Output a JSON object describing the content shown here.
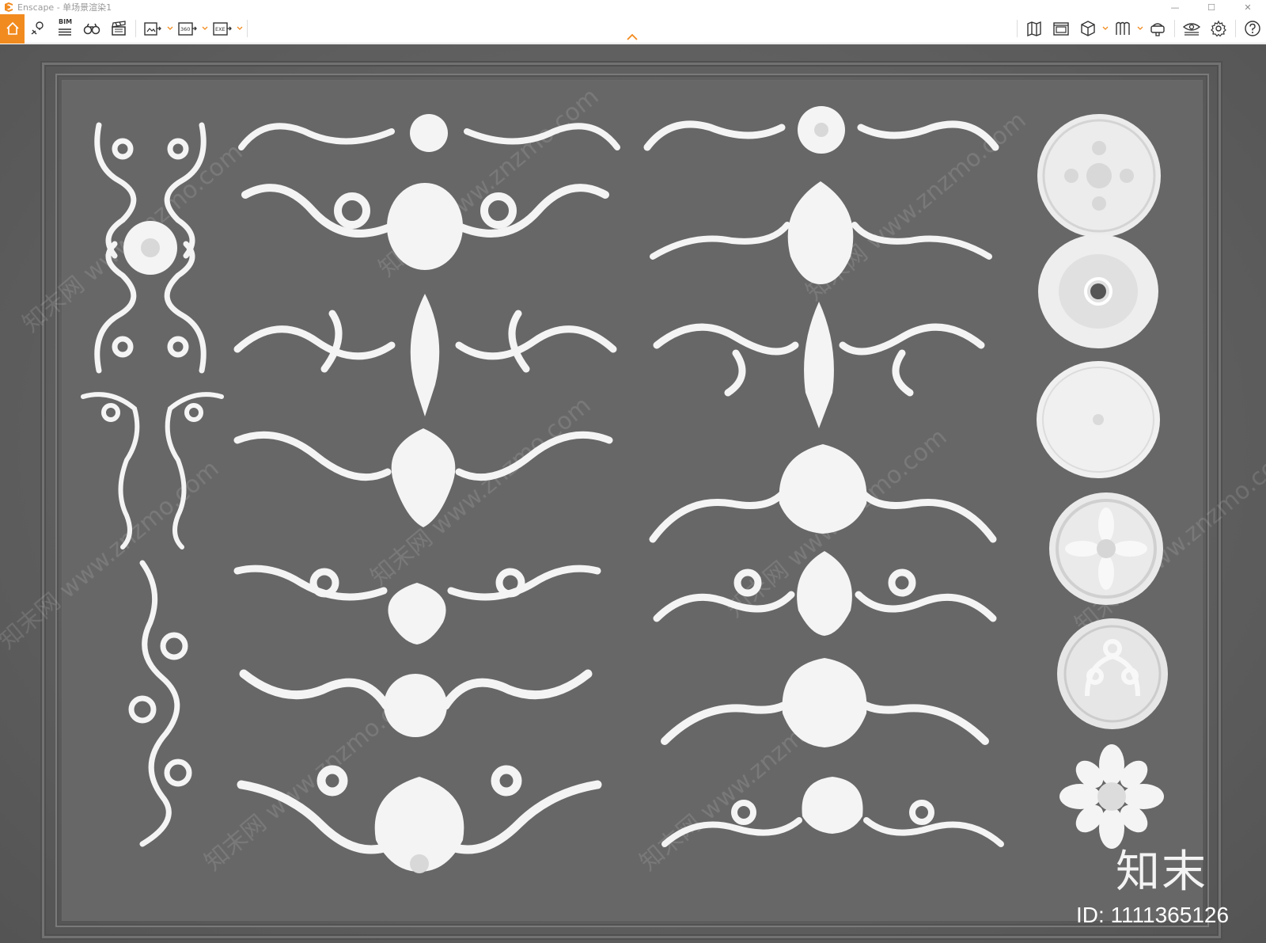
{
  "window": {
    "app_name": "Enscape",
    "title": "Enscape - 单场景渲染1",
    "controls": {
      "minimize": "—",
      "maximize": "☐",
      "close": "✕"
    }
  },
  "toolbar": {
    "left": [
      {
        "name": "home",
        "icon": "home-icon",
        "accent": "#f28b1f"
      },
      {
        "name": "view-management",
        "icon": "map-pin-icon"
      },
      {
        "name": "bim",
        "icon": "bim-icon",
        "label": "BIM"
      },
      {
        "name": "walk-mode",
        "icon": "binoculars-icon"
      },
      {
        "name": "video-editor",
        "icon": "clapboard-icon"
      },
      {
        "name": "screenshot",
        "icon": "image-export-icon",
        "dropdown": true
      },
      {
        "name": "panorama",
        "icon": "panorama-360-icon",
        "label": "360",
        "dropdown": true
      },
      {
        "name": "exe-export",
        "icon": "exe-export-icon",
        "label": "EXE",
        "dropdown": true
      }
    ],
    "right": [
      {
        "name": "map",
        "icon": "map-icon"
      },
      {
        "name": "minimap",
        "icon": "minimap-icon"
      },
      {
        "name": "section",
        "icon": "cube-icon",
        "dropdown": true
      },
      {
        "name": "asset-library",
        "icon": "asset-library-icon",
        "dropdown": true
      },
      {
        "name": "vr-headset",
        "icon": "vr-headset-icon"
      },
      {
        "name": "visual-settings",
        "icon": "eye-settings-icon"
      },
      {
        "name": "settings",
        "icon": "gear-icon"
      },
      {
        "name": "help",
        "icon": "help-icon"
      }
    ],
    "collapse": {
      "icon": "chevron-up-icon",
      "color": "#f28b1f"
    }
  },
  "viewport": {
    "background": "#626262",
    "ornament_color": "#f4f4f4",
    "watermark_text": "知末网 www.znzmo.com",
    "brand_mark": "知末",
    "id_text": "ID: 1111365126"
  }
}
